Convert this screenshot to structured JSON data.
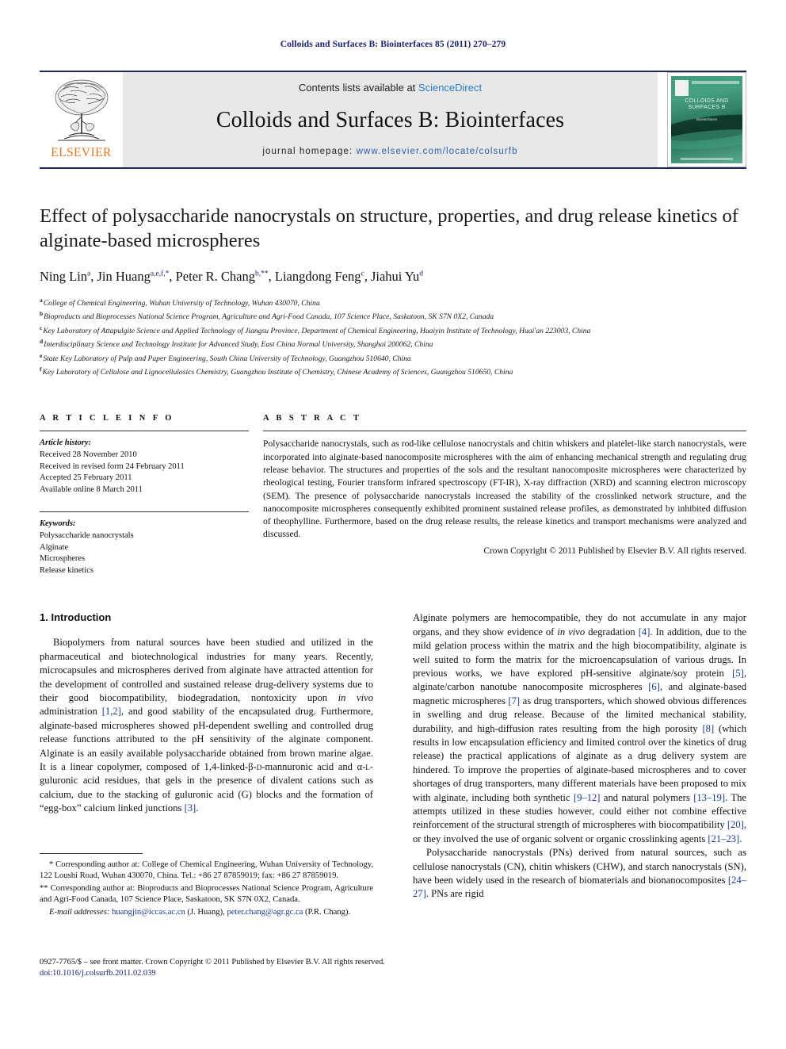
{
  "running_head": "Colloids and Surfaces B: Biointerfaces 85 (2011) 270–279",
  "masthead": {
    "contents_prefix": "Contents lists available at ",
    "sciencedirect": "ScienceDirect",
    "journal_title": "Colloids and Surfaces B: Biointerfaces",
    "homepage_prefix": "journal homepage: ",
    "homepage_url": "www.elsevier.com/locate/colsurfb",
    "publisher": "ELSEVIER",
    "cover": {
      "title": "COLLOIDS AND SURFACES B",
      "subtitle": "Biointerfaces"
    },
    "colors": {
      "rule": "#1a2a5e",
      "band": "#e8e8e8",
      "link": "#2b7dc0",
      "elsevier_orange": "#E87722",
      "cover_green": "#2f7f66"
    }
  },
  "article": {
    "title": "Effect of polysaccharide nanocrystals on structure, properties, and drug release kinetics of alginate-based microspheres",
    "authors": [
      {
        "name": "Ning Lin",
        "sup": "a",
        "sep": ", "
      },
      {
        "name": "Jin Huang",
        "sup": "a,e,f,",
        "star": "*",
        "sep": ", "
      },
      {
        "name": "Peter R. Chang",
        "sup": "b,",
        "star": "**",
        "sep": ", "
      },
      {
        "name": "Liangdong Feng",
        "sup": "c",
        "sep": ", "
      },
      {
        "name": "Jiahui Yu",
        "sup": "d",
        "sep": ""
      }
    ],
    "affiliations": [
      {
        "label": "a",
        "text": "College of Chemical Engineering, Wuhan University of Technology, Wuhan 430070, China"
      },
      {
        "label": "b",
        "text": "Bioproducts and Bioprocesses National Science Program, Agriculture and Agri-Food Canada, 107 Science Place, Saskatoon, SK S7N 0X2, Canada"
      },
      {
        "label": "c",
        "text": "Key Laboratory of Attapulgite Science and Applied Technology of Jiangsu Province, Department of Chemical Engineering, Huaiyin Institute of Technology, Huai'an 223003, China"
      },
      {
        "label": "d",
        "text": "Interdisciplinary Science and Technology Institute for Advanced Study, East China Normal University, Shanghai 200062, China"
      },
      {
        "label": "e",
        "text": "State Key Laboratory of Pulp and Paper Engineering, South China University of Technology, Guangzhou 510640, China"
      },
      {
        "label": "f",
        "text": "Key Laboratory of Cellulose and Lignocellulosics Chemistry, Guangzhou Institute of Chemistry, Chinese Academy of Sciences, Guangzhou 510650, China"
      }
    ]
  },
  "article_info": {
    "heading": "A R T I C L E    I N F O",
    "history_label": "Article history:",
    "history": [
      "Received 28 November 2010",
      "Received in revised form 24 February 2011",
      "Accepted 25 February 2011",
      "Available online 8 March 2011"
    ],
    "keywords_label": "Keywords:",
    "keywords": [
      "Polysaccharide nanocrystals",
      "Alginate",
      "Microspheres",
      "Release kinetics"
    ]
  },
  "abstract": {
    "heading": "A B S T R A C T",
    "text": "Polysaccharide nanocrystals, such as rod-like cellulose nanocrystals and chitin whiskers and platelet-like starch nanocrystals, were incorporated into alginate-based nanocomposite microspheres with the aim of enhancing mechanical strength and regulating drug release behavior. The structures and properties of the sols and the resultant nanocomposite microspheres were characterized by rheological testing, Fourier transform infrared spectroscopy (FT-IR), X-ray diffraction (XRD) and scanning electron microscopy (SEM). The presence of polysaccharide nanocrystals increased the stability of the crosslinked network structure, and the nanocomposite microspheres consequently exhibited prominent sustained release profiles, as demonstrated by inhibited diffusion of theophylline. Furthermore, based on the drug release results, the release kinetics and transport mechanisms were analyzed and discussed.",
    "copyright": "Crown Copyright © 2011 Published by Elsevier B.V. All rights reserved."
  },
  "introduction": {
    "heading": "1. Introduction",
    "left_paragraph_parts": {
      "p1_a": "Biopolymers from natural sources have been studied and utilized in the pharmaceutical and biotechnological industries for many years. Recently, microcapsules and microspheres derived from alginate have attracted attention for the development of controlled and sustained release drug-delivery systems due to their good biocompatibility, biodegradation, nontoxicity upon ",
      "p1_ital1": "in vivo",
      "p1_b": " administration ",
      "p1_ref1": "[1,2]",
      "p1_c": ", and good stability of the encapsulated drug. Furthermore, alginate-based microspheres showed pH-dependent swelling and controlled drug release functions attributed to the pH sensitivity of the alginate component. Alginate is an easily available polysaccharide obtained from brown marine algae. It is a linear copolymer, composed of 1,4-linked-β-",
      "p1_sc1": "d",
      "p1_d": "-mannuronic acid and α-",
      "p1_sc2": "l",
      "p1_e": "-guluronic acid residues, that gels in the presence of divalent cations such as calcium, due to the stacking of guluronic acid (G) blocks and the formation of “egg-box” calcium linked junctions ",
      "p1_ref2": "[3]",
      "p1_f": "."
    },
    "right_paragraph_parts": {
      "p2_a": "Alginate polymers are hemocompatible, they do not accumulate in any major organs, and they show evidence of ",
      "p2_ital1": "in vivo",
      "p2_b": " degradation ",
      "p2_ref1": "[4]",
      "p2_c": ". In addition, due to the mild gelation process within the matrix and the high biocompatibility, alginate is well suited to form the matrix for the microencapsulation of various drugs. In previous works, we have explored pH-sensitive alginate/soy protein ",
      "p2_ref2": "[5]",
      "p2_d": ", alginate/carbon nanotube nanocomposite microspheres ",
      "p2_ref3": "[6]",
      "p2_e": ", and alginate-based magnetic microspheres ",
      "p2_ref4": "[7]",
      "p2_f": " as drug transporters, which showed obvious differences in swelling and drug release. Because of the limited mechanical stability, durability, and high-diffusion rates resulting from the high porosity ",
      "p2_ref5": "[8]",
      "p2_g": " (which results in low encapsulation efficiency and limited control over the kinetics of drug release) the practical applications of alginate as a drug delivery system are hindered. To improve the properties of alginate-based microspheres and to cover shortages of drug transporters, many different materials have been proposed to mix with alginate, including both synthetic ",
      "p2_ref6": "[9–12]",
      "p2_h": " and natural polymers ",
      "p2_ref7": "[13–19]",
      "p2_i": ". The attempts utilized in these studies however, could either not combine effective reinforcement of the structural strength of microspheres with biocompatibility ",
      "p2_ref8": "[20]",
      "p2_j": ", or they involved the use of organic solvent or organic crosslinking agents ",
      "p2_ref9": "[21–23]",
      "p2_k": ".",
      "p3_a": "Polysaccharide nanocrystals (PNs) derived from natural sources, such as cellulose nanocrystals (CN), chitin whiskers (CHW), and starch nanocrystals (SN), have been widely used in the research of biomaterials and bionanocomposites ",
      "p3_ref1": "[24–27]",
      "p3_b": ". PNs are rigid"
    }
  },
  "footnotes": {
    "star1": "*",
    "fn1": " Corresponding author at: College of Chemical Engineering, Wuhan University of Technology, 122 Loushi Road, Wuhan 430070, China. Tel.: +86 27 87859019; fax: +86 27 87859019.",
    "star2": "**",
    "fn2": " Corresponding author at: Bioproducts and Bioprocesses National Science Program, Agriculture and Agri-Food Canada, 107 Science Place, Saskatoon, SK S7N 0X2, Canada.",
    "email_label": "E-mail addresses:",
    "email1": "huangjin@iccas.ac.cn",
    "email1_owner": " (J. Huang), ",
    "email2": "peter.chang@agr.gc.ca",
    "email2_owner": " (P.R. Chang)."
  },
  "page_footer": {
    "line1": "0927-7765/$ – see front matter. Crown Copyright © 2011 Published by Elsevier B.V. All rights reserved.",
    "doi": "doi:10.1016/j.colsurfb.2011.02.039"
  }
}
